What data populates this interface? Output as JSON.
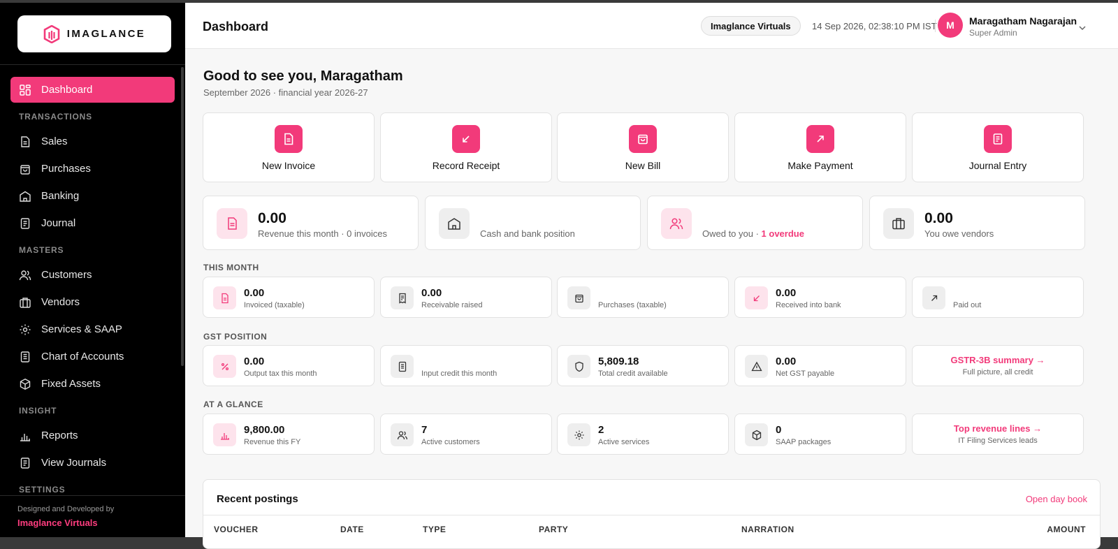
{
  "brand": {
    "name": "IMAGLANCE"
  },
  "sidebar": {
    "dashboard": "Dashboard",
    "sections": {
      "transactions": "TRANSACTIONS",
      "masters": "MASTERS",
      "insight": "INSIGHT",
      "settings": "SETTINGS"
    },
    "items": {
      "sales": "Sales",
      "purchases": "Purchases",
      "banking": "Banking",
      "journal": "Journal",
      "customers": "Customers",
      "vendors": "Vendors",
      "services": "Services & SAAP",
      "coa": "Chart of Accounts",
      "fixed_assets": "Fixed Assets",
      "reports": "Reports",
      "view_journals": "View Journals"
    },
    "footer": {
      "line1": "Designed and Developed by",
      "line2": "Imaglance Virtuals"
    }
  },
  "header": {
    "title": "Dashboard",
    "org": "Imaglance Virtuals",
    "datetime": "14 Sep 2026, 02:38:10 PM IST",
    "avatar_letter": "M",
    "user_name": "Maragatham Nagarajan",
    "user_role": "Super Admin"
  },
  "greeting": {
    "title": "Good to see you, Maragatham",
    "subtitle": "September 2026 · financial year 2026-27"
  },
  "quick_actions": [
    {
      "label": "New Invoice"
    },
    {
      "label": "Record Receipt"
    },
    {
      "label": "New Bill"
    },
    {
      "label": "Make Payment"
    },
    {
      "label": "Journal Entry"
    }
  ],
  "kpis": [
    {
      "value": "0.00",
      "label": "Revenue this month · 0 invoices"
    },
    {
      "value": "",
      "label": "Cash and bank position"
    },
    {
      "value": "",
      "label": "Owed to you · ",
      "highlight": "1 overdue"
    },
    {
      "value": "0.00",
      "label": "You owe vendors"
    }
  ],
  "this_month": {
    "title": "THIS MONTH",
    "cards": [
      {
        "value": "0.00",
        "label": "Invoiced (taxable)"
      },
      {
        "value": "0.00",
        "label": "Receivable raised"
      },
      {
        "value": "",
        "label": "Purchases (taxable)"
      },
      {
        "value": "0.00",
        "label": "Received into bank"
      },
      {
        "value": "",
        "label": "Paid out"
      }
    ]
  },
  "gst": {
    "title": "GST POSITION",
    "cards": [
      {
        "value": "0.00",
        "label": "Output tax this month"
      },
      {
        "value": "",
        "label": "Input credit this month"
      },
      {
        "value": "5,809.18",
        "label": "Total credit available"
      },
      {
        "value": "0.00",
        "label": "Net GST payable"
      }
    ],
    "link": {
      "title": "GSTR-3B summary →",
      "sub": "Full picture, all credit"
    }
  },
  "glance": {
    "title": "AT A GLANCE",
    "cards": [
      {
        "value": "9,800.00",
        "label": "Revenue this FY"
      },
      {
        "value": "7",
        "label": "Active customers"
      },
      {
        "value": "2",
        "label": "Active services"
      },
      {
        "value": "0",
        "label": "SAAP packages"
      }
    ],
    "link": {
      "title": "Top revenue lines →",
      "sub": "IT Filing Services leads"
    }
  },
  "recent": {
    "title": "Recent postings",
    "link": "Open day book",
    "columns": [
      "VOUCHER",
      "DATE",
      "TYPE",
      "PARTY",
      "NARRATION",
      "AMOUNT"
    ]
  },
  "colors": {
    "accent": "#f23a7a",
    "sidebar_bg": "#000000"
  }
}
